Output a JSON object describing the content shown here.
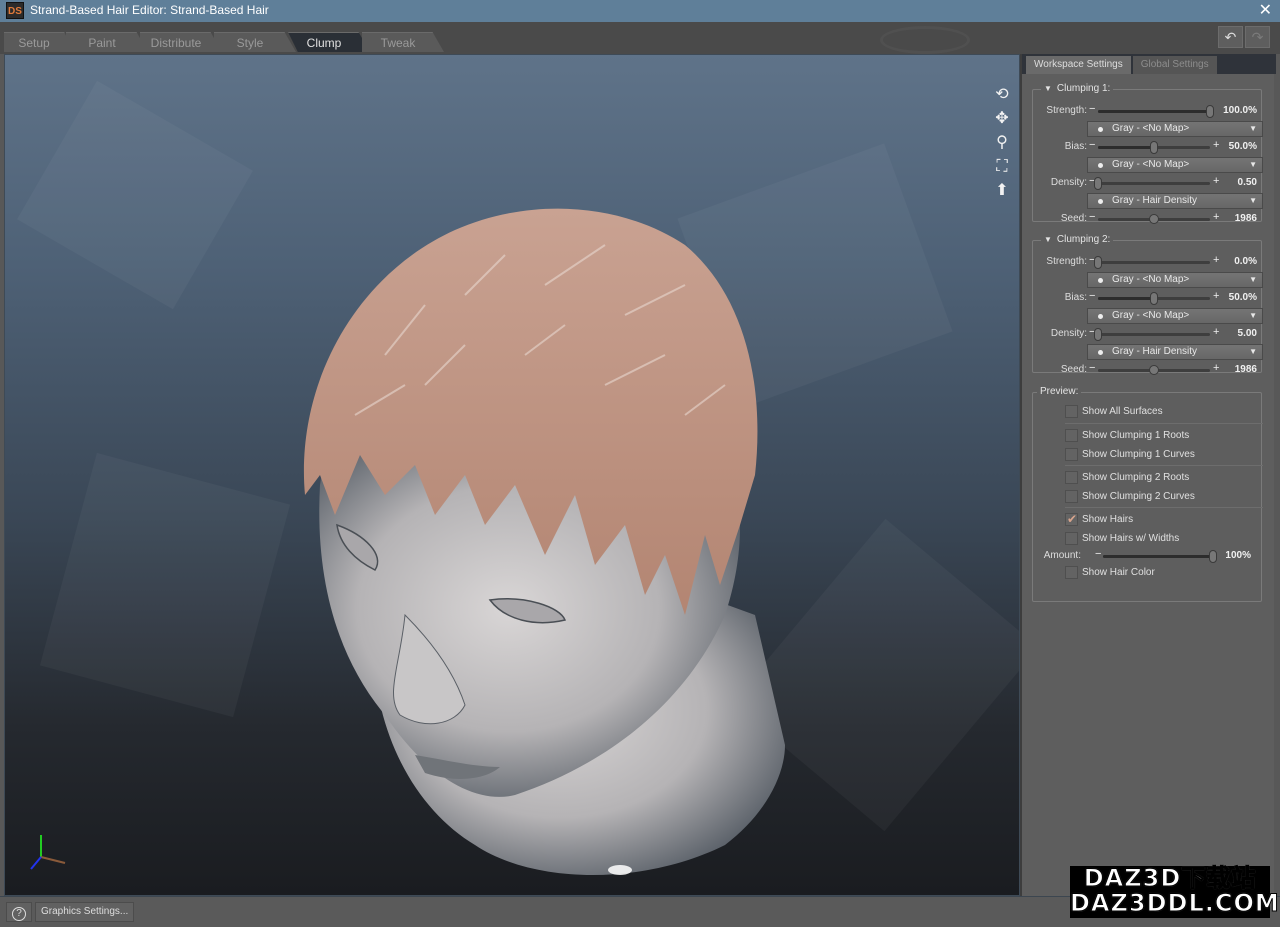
{
  "window": {
    "app_icon": "DS",
    "title": "Strand-Based Hair Editor: Strand-Based Hair",
    "close_icon": "✕"
  },
  "tabs": [
    {
      "label": "Setup",
      "active": false
    },
    {
      "label": "Paint",
      "active": false
    },
    {
      "label": "Distribute",
      "active": false
    },
    {
      "label": "Style",
      "active": false
    },
    {
      "label": "Clump",
      "active": true
    },
    {
      "label": "Tweak",
      "active": false
    }
  ],
  "toolbar": {
    "undo_icon": "↶",
    "redo_icon": "↷"
  },
  "viewport": {
    "nav_icons": [
      {
        "name": "orbit-icon",
        "glyph": "⟲"
      },
      {
        "name": "pan-icon",
        "glyph": "✥"
      },
      {
        "name": "zoom-icon",
        "glyph": "⚲"
      },
      {
        "name": "frame-icon",
        "glyph": "⛶"
      },
      {
        "name": "reset-view-icon",
        "glyph": "⬆"
      }
    ],
    "axis_colors": {
      "y": "#22cc22",
      "x": "#8a5a3a",
      "z": "#2233ee"
    }
  },
  "panel": {
    "tabs": [
      "Workspace Settings",
      "Global Settings"
    ],
    "clumping1": {
      "title": "Clumping 1:",
      "strength": {
        "label": "Strength:",
        "value": "100.0%",
        "fraction": 1.0
      },
      "strength_map": "Gray - <No Map>",
      "bias": {
        "label": "Bias:",
        "value": "50.0%",
        "fraction": 0.5
      },
      "bias_map": "Gray - <No Map>",
      "density": {
        "label": "Density:",
        "value": "0.50",
        "fraction": 0.0
      },
      "density_map": "Gray - Hair Density",
      "seed": {
        "label": "Seed:",
        "value": "1986",
        "fraction": 0.5
      }
    },
    "clumping2": {
      "title": "Clumping 2:",
      "strength": {
        "label": "Strength:",
        "value": "0.0%",
        "fraction": 0.0
      },
      "strength_map": "Gray - <No Map>",
      "bias": {
        "label": "Bias:",
        "value": "50.0%",
        "fraction": 0.5
      },
      "bias_map": "Gray - <No Map>",
      "density": {
        "label": "Density:",
        "value": "5.00",
        "fraction": 0.0
      },
      "density_map": "Gray - Hair Density",
      "seed": {
        "label": "Seed:",
        "value": "1986",
        "fraction": 0.5
      }
    },
    "preview": {
      "title": "Preview:",
      "show_all_surfaces": {
        "label": "Show All Surfaces",
        "checked": false
      },
      "show_clumping1_roots": {
        "label": "Show Clumping 1 Roots",
        "checked": false
      },
      "show_clumping1_curves": {
        "label": "Show Clumping 1 Curves",
        "checked": false
      },
      "show_clumping2_roots": {
        "label": "Show Clumping 2 Roots",
        "checked": false
      },
      "show_clumping2_curves": {
        "label": "Show Clumping 2 Curves",
        "checked": false
      },
      "show_hairs": {
        "label": "Show Hairs",
        "checked": true
      },
      "show_hairs_widths": {
        "label": "Show Hairs w/ Widths",
        "checked": false
      },
      "amount": {
        "label": "Amount:",
        "value": "100%",
        "fraction": 1.0
      },
      "show_hair_color": {
        "label": "Show Hair Color",
        "checked": false
      }
    }
  },
  "bottom": {
    "help_label": "?",
    "graphics_settings_label": "Graphics Settings..."
  },
  "watermark": {
    "line1": "DAZ3D下载站",
    "line2": "DAZ3DDL.COM"
  }
}
